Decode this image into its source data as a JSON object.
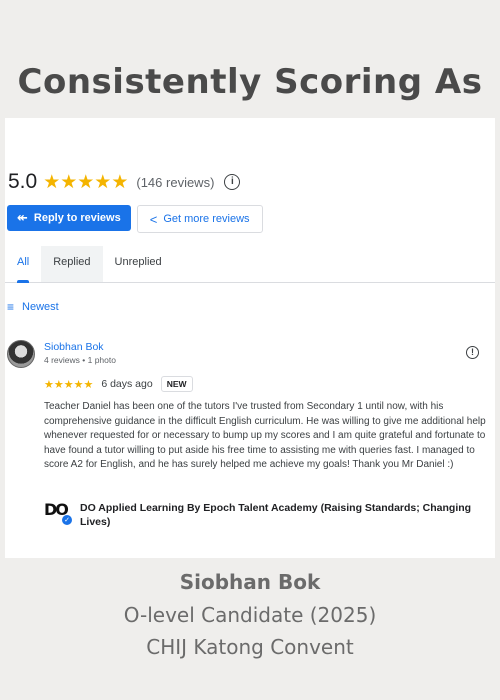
{
  "headline": "Consistently Scoring As",
  "rating": {
    "score": "5.0",
    "stars": "★★★★★",
    "count": "(146 reviews)",
    "info_icon": "i"
  },
  "actions": {
    "reply_label": "Reply to reviews",
    "more_label": "Get more reviews"
  },
  "tabs": [
    "All",
    "Replied",
    "Unreplied"
  ],
  "sort_label": "Newest",
  "review": {
    "name": "Siobhan Bok",
    "meta": "4 reviews • 1 photo",
    "stars": "★★★★★",
    "age": "6 days ago",
    "badge": "NEW",
    "text": "Teacher Daniel has been one of the tutors I've trusted from Secondary 1 until now, with his comprehensive guidance in the difficult English curriculum. He was willing to give me additional help whenever requested for or necessary to bump up my scores and I am quite grateful and fortunate to have found a tutor willing to put aside his free time to assisting me with queries fast. I managed to score A2 for English, and he has surely helped me achieve my goals! Thank you Mr Daniel :)",
    "business_logo": "DO",
    "business": "DO Applied Learning By Epoch Talent Academy (Raising Standards; Changing Lives)"
  },
  "footer": {
    "name": "Siobhan Bok",
    "role": "O-level Candidate (2025)",
    "school": "CHIJ Katong Convent"
  },
  "colors": {
    "accent": "#1a73e8",
    "star": "#f4b400",
    "background": "#efeeec"
  }
}
